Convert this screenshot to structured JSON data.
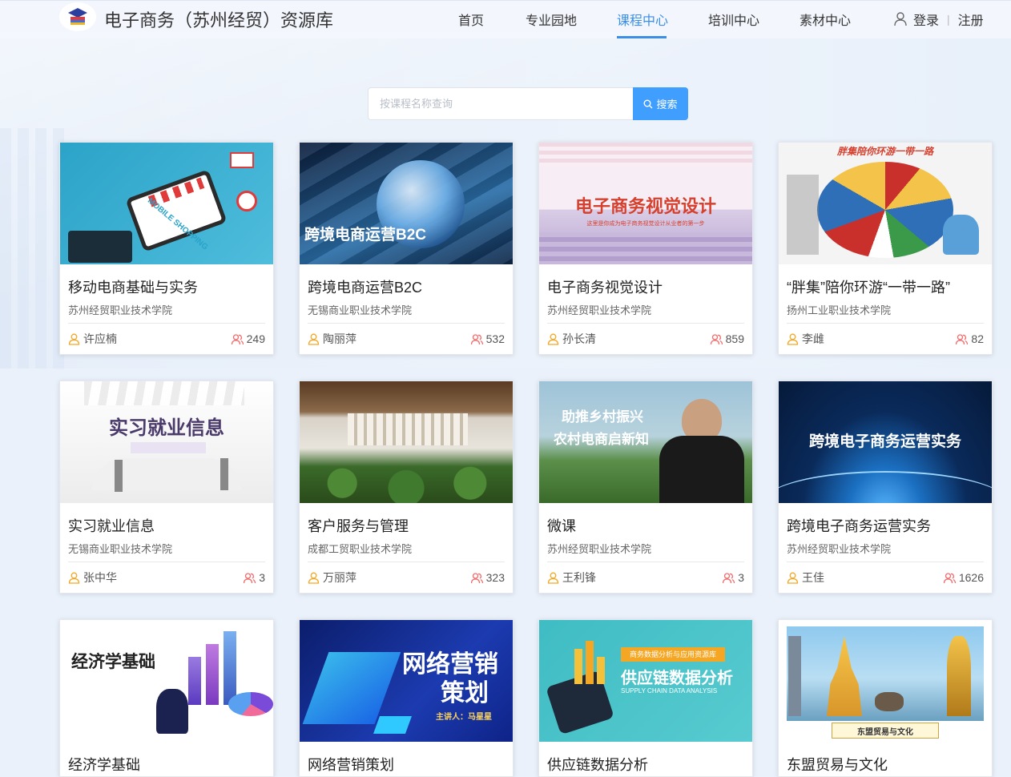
{
  "header": {
    "site_title": "电子商务（苏州经贸）资源库",
    "nav": [
      {
        "label": "首页",
        "active": false
      },
      {
        "label": "专业园地",
        "active": false
      },
      {
        "label": "课程中心",
        "active": true
      },
      {
        "label": "培训中心",
        "active": false
      },
      {
        "label": "素材中心",
        "active": false
      }
    ],
    "login_label": "登录",
    "register_label": "注册",
    "accent_color": "#3a8ee6"
  },
  "search": {
    "placeholder": "按课程名称查询",
    "button_label": "搜索",
    "button_color": "#409eff"
  },
  "courses": [
    {
      "title": "移动电商基础与实务",
      "school": "苏州经贸职业技术学院",
      "teacher": "许应楠",
      "count": "249",
      "thumb_text": "MOBILE SHOPPING",
      "thumb_colors": [
        "#2b9fc6",
        "#49b8d8"
      ]
    },
    {
      "title": "跨境电商运营B2C",
      "school": "无锡商业职业技术学院",
      "teacher": "陶丽萍",
      "count": "532",
      "thumb_text": "跨境电商运营B2C",
      "thumb_colors": [
        "#0f2f55",
        "#2a6ea8"
      ]
    },
    {
      "title": "电子商务视觉设计",
      "school": "苏州经贸职业技术学院",
      "teacher": "孙长清",
      "count": "859",
      "thumb_text": "电子商务视觉设计",
      "thumb_sub": "这里是你成为电子商务视觉设计从业者的第一步",
      "thumb_colors": [
        "#f2e9f2",
        "#b9a6d2"
      ]
    },
    {
      "title": "“胖集”陪你环游“一带一路”",
      "school": "扬州工业职业技术学院",
      "teacher": "李雌",
      "count": "82",
      "thumb_text": "胖集陪你环游一带一路",
      "thumb_colors": [
        "#f4f4f4",
        "#c9302c"
      ]
    },
    {
      "title": "实习就业信息",
      "school": "无锡商业职业技术学院",
      "teacher": "张中华",
      "count": "3",
      "thumb_text": "实习就业信息",
      "thumb_colors": [
        "#ffffff",
        "#e6e6e6"
      ]
    },
    {
      "title": "客户服务与管理",
      "school": "成都工贸职业技术学院",
      "teacher": "万丽萍",
      "count": "323",
      "thumb_text": "",
      "thumb_colors": [
        "#7a4a2a",
        "#2e5a22"
      ]
    },
    {
      "title": "微课",
      "school": "苏州经贸职业技术学院",
      "teacher": "王利锋",
      "count": "3",
      "thumb_text": "助推乡村振兴",
      "thumb_sub": "农村电商启新知",
      "thumb_colors": [
        "#8ab3c9",
        "#3f7a3c"
      ]
    },
    {
      "title": "跨境电子商务运营实务",
      "school": "苏州经贸职业技术学院",
      "teacher": "王佳",
      "count": "1626",
      "thumb_text": "跨境电子商务运营实务",
      "thumb_colors": [
        "#061a3a",
        "#1b6fc1"
      ]
    },
    {
      "title": "经济学基础",
      "school": "",
      "teacher": "",
      "count": "",
      "thumb_text": "经济学基础",
      "thumb_colors": [
        "#ffffff",
        "#e9e2f6"
      ]
    },
    {
      "title": "网络营销策划",
      "school": "",
      "teacher": "",
      "count": "",
      "thumb_text": "网络营销",
      "thumb_sub": "策划",
      "thumb_sub2": "主讲人：马星星",
      "thumb_colors": [
        "#0b1d6b",
        "#1c3bb0"
      ]
    },
    {
      "title": "供应链数据分析",
      "school": "",
      "teacher": "",
      "count": "",
      "thumb_text": "供应链数据分析",
      "thumb_tag": "商务数据分析与应用资源库",
      "thumb_sub": "SUPPLY CHAIN DATA ANALYSIS",
      "thumb_colors": [
        "#3fbcc3",
        "#57cbd0"
      ]
    },
    {
      "title": "东盟贸易与文化",
      "school": "",
      "teacher": "",
      "count": "",
      "thumb_text": "东盟贸易与文化",
      "thumb_colors": [
        "#9fd2ef",
        "#f3c34a"
      ]
    }
  ]
}
